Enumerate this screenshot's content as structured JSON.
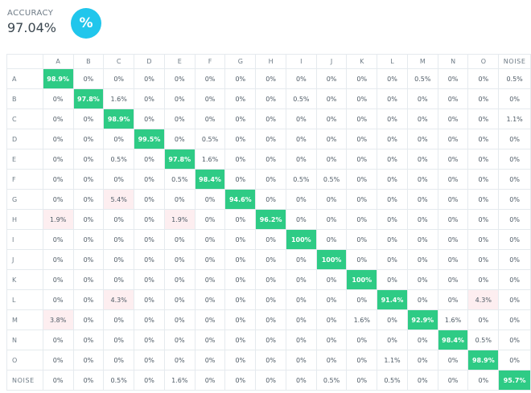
{
  "accuracy": {
    "label": "ACCURACY",
    "value": "97.04%",
    "icon": "percent-icon",
    "icon_glyph": "%",
    "badge_color": "#20c6ec"
  },
  "matrix": {
    "columns": [
      "A",
      "B",
      "C",
      "D",
      "E",
      "F",
      "G",
      "H",
      "I",
      "J",
      "K",
      "L",
      "M",
      "N",
      "O",
      "NOISE"
    ],
    "rows": [
      {
        "label": "A",
        "cells": [
          "98.9%",
          "0%",
          "0%",
          "0%",
          "0%",
          "0%",
          "0%",
          "0%",
          "0%",
          "0%",
          "0%",
          "0%",
          "0.5%",
          "0%",
          "0%",
          "0.5%"
        ]
      },
      {
        "label": "B",
        "cells": [
          "0%",
          "97.8%",
          "1.6%",
          "0%",
          "0%",
          "0%",
          "0%",
          "0%",
          "0.5%",
          "0%",
          "0%",
          "0%",
          "0%",
          "0%",
          "0%",
          "0%"
        ]
      },
      {
        "label": "C",
        "cells": [
          "0%",
          "0%",
          "98.9%",
          "0%",
          "0%",
          "0%",
          "0%",
          "0%",
          "0%",
          "0%",
          "0%",
          "0%",
          "0%",
          "0%",
          "0%",
          "1.1%"
        ]
      },
      {
        "label": "D",
        "cells": [
          "0%",
          "0%",
          "0%",
          "99.5%",
          "0%",
          "0.5%",
          "0%",
          "0%",
          "0%",
          "0%",
          "0%",
          "0%",
          "0%",
          "0%",
          "0%",
          "0%"
        ]
      },
      {
        "label": "E",
        "cells": [
          "0%",
          "0%",
          "0.5%",
          "0%",
          "97.8%",
          "1.6%",
          "0%",
          "0%",
          "0%",
          "0%",
          "0%",
          "0%",
          "0%",
          "0%",
          "0%",
          "0%"
        ]
      },
      {
        "label": "F",
        "cells": [
          "0%",
          "0%",
          "0%",
          "0%",
          "0.5%",
          "98.4%",
          "0%",
          "0%",
          "0.5%",
          "0.5%",
          "0%",
          "0%",
          "0%",
          "0%",
          "0%",
          "0%"
        ]
      },
      {
        "label": "G",
        "cells": [
          "0%",
          "0%",
          "5.4%",
          "0%",
          "0%",
          "0%",
          "94.6%",
          "0%",
          "0%",
          "0%",
          "0%",
          "0%",
          "0%",
          "0%",
          "0%",
          "0%"
        ]
      },
      {
        "label": "H",
        "cells": [
          "1.9%",
          "0%",
          "0%",
          "0%",
          "1.9%",
          "0%",
          "0%",
          "96.2%",
          "0%",
          "0%",
          "0%",
          "0%",
          "0%",
          "0%",
          "0%",
          "0%"
        ]
      },
      {
        "label": "I",
        "cells": [
          "0%",
          "0%",
          "0%",
          "0%",
          "0%",
          "0%",
          "0%",
          "0%",
          "100%",
          "0%",
          "0%",
          "0%",
          "0%",
          "0%",
          "0%",
          "0%"
        ]
      },
      {
        "label": "J",
        "cells": [
          "0%",
          "0%",
          "0%",
          "0%",
          "0%",
          "0%",
          "0%",
          "0%",
          "0%",
          "100%",
          "0%",
          "0%",
          "0%",
          "0%",
          "0%",
          "0%"
        ]
      },
      {
        "label": "K",
        "cells": [
          "0%",
          "0%",
          "0%",
          "0%",
          "0%",
          "0%",
          "0%",
          "0%",
          "0%",
          "0%",
          "100%",
          "0%",
          "0%",
          "0%",
          "0%",
          "0%"
        ]
      },
      {
        "label": "L",
        "cells": [
          "0%",
          "0%",
          "4.3%",
          "0%",
          "0%",
          "0%",
          "0%",
          "0%",
          "0%",
          "0%",
          "0%",
          "91.4%",
          "0%",
          "0%",
          "4.3%",
          "0%"
        ]
      },
      {
        "label": "M",
        "cells": [
          "3.8%",
          "0%",
          "0%",
          "0%",
          "0%",
          "0%",
          "0%",
          "0%",
          "0%",
          "0%",
          "1.6%",
          "0%",
          "92.9%",
          "1.6%",
          "0%",
          "0%"
        ]
      },
      {
        "label": "N",
        "cells": [
          "0%",
          "0%",
          "0%",
          "0%",
          "0%",
          "0%",
          "0%",
          "0%",
          "0%",
          "0%",
          "0%",
          "0%",
          "0%",
          "98.4%",
          "0.5%",
          "0%"
        ]
      },
      {
        "label": "O",
        "cells": [
          "0%",
          "0%",
          "0%",
          "0%",
          "0%",
          "0%",
          "0%",
          "0%",
          "0%",
          "0%",
          "0%",
          "1.1%",
          "0%",
          "0%",
          "98.9%",
          "0%"
        ]
      },
      {
        "label": "NOISE",
        "cells": [
          "0%",
          "0%",
          "0.5%",
          "0%",
          "1.6%",
          "0%",
          "0%",
          "0%",
          "0%",
          "0.5%",
          "0%",
          "0.5%",
          "0%",
          "0%",
          "0%",
          "95.7%"
        ]
      }
    ],
    "colors": {
      "correct_cell": "#2ecb85",
      "error_highlight": "#fdeef0",
      "grid": "#e5eaee"
    }
  }
}
